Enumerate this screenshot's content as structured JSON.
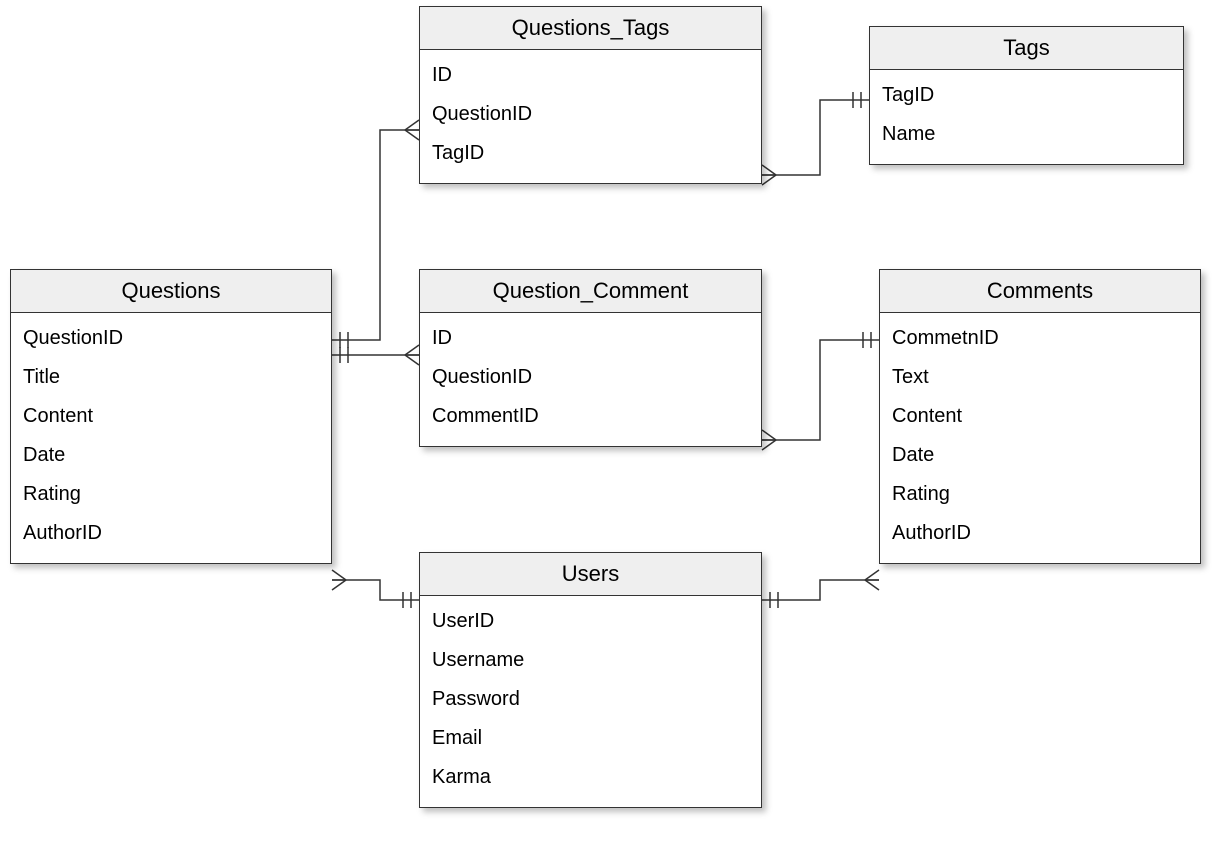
{
  "entities": {
    "questions_tags": {
      "title": "Questions_Tags",
      "fields": [
        "ID",
        "QuestionID",
        "TagID"
      ]
    },
    "tags": {
      "title": "Tags",
      "fields": [
        "TagID",
        "Name"
      ]
    },
    "questions": {
      "title": "Questions",
      "fields": [
        "QuestionID",
        "Title",
        "Content",
        "Date",
        "Rating",
        "AuthorID"
      ]
    },
    "question_comment": {
      "title": "Question_Comment",
      "fields": [
        "ID",
        "QuestionID",
        "CommentID"
      ]
    },
    "comments": {
      "title": "Comments",
      "fields": [
        "CommetnID",
        "Text",
        "Content",
        "Date",
        "Rating",
        "AuthorID"
      ]
    },
    "users": {
      "title": "Users",
      "fields": [
        "UserID",
        "Username",
        "Password",
        "Email",
        "Karma"
      ]
    }
  },
  "relationships": [
    {
      "from": "Questions",
      "to": "Questions_Tags",
      "type": "one-to-many"
    },
    {
      "from": "Tags",
      "to": "Questions_Tags",
      "type": "one-to-many"
    },
    {
      "from": "Questions",
      "to": "Question_Comment",
      "type": "one-to-many"
    },
    {
      "from": "Comments",
      "to": "Question_Comment",
      "type": "one-to-many"
    },
    {
      "from": "Users",
      "to": "Questions",
      "type": "one-to-many"
    },
    {
      "from": "Users",
      "to": "Comments",
      "type": "one-to-many"
    }
  ]
}
